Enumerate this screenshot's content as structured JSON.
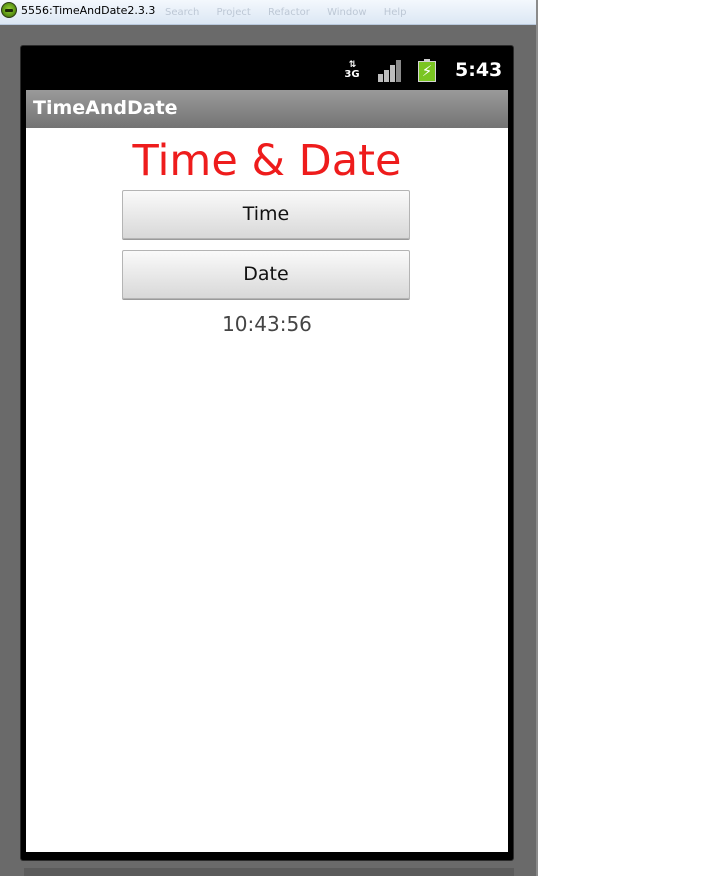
{
  "window": {
    "title": "5556:TimeAndDate2.3.3",
    "background_menus": [
      "Search",
      "Project",
      "Refactor",
      "Window",
      "Help"
    ]
  },
  "status_bar": {
    "network_label": "3G",
    "time": "5:43",
    "icons": [
      "data-3g-icon",
      "signal-strength-icon",
      "battery-charging-icon"
    ],
    "battery_color": "#7ac521"
  },
  "app_bar": {
    "title": "TimeAndDate"
  },
  "main": {
    "heading": "Time & Date",
    "heading_color": "#ee1c1c",
    "time_button_label": "Time",
    "date_button_label": "Date",
    "readout": "10:43:56"
  }
}
